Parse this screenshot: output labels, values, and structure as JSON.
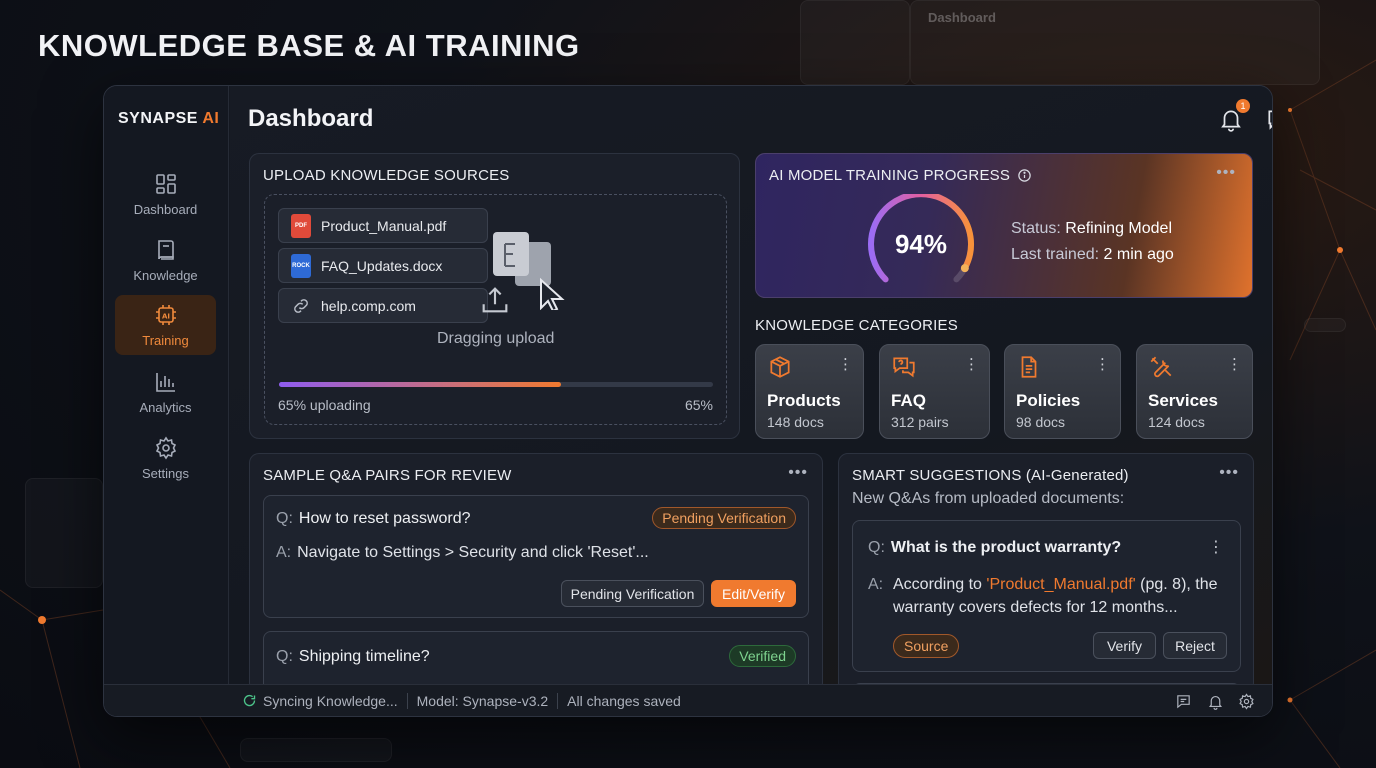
{
  "page_title": "KNOWLEDGE BASE & AI TRAINING",
  "ghost": {
    "title": "Dashboard"
  },
  "app": {
    "logo_main": "SYNAPSE",
    "logo_accent": "AI"
  },
  "sidebar": {
    "items": [
      {
        "label": "Dashboard",
        "icon": "grid-icon",
        "active": false
      },
      {
        "label": "Knowledge",
        "icon": "book-icon",
        "active": false
      },
      {
        "label": "Training",
        "icon": "ai-chip-icon",
        "active": true
      },
      {
        "label": "Analytics",
        "icon": "bar-chart-icon",
        "active": false
      },
      {
        "label": "Settings",
        "icon": "gear-icon",
        "active": false
      }
    ]
  },
  "header": {
    "title": "Dashboard",
    "notification_count": "1"
  },
  "upload": {
    "title": "UPLOAD KNOWLEDGE SOURCES",
    "files": [
      {
        "name": "Product_Manual.pdf",
        "type_label": "PDF",
        "color": "#e04a3a"
      },
      {
        "name": "FAQ_Updates.docx",
        "type_label": "ROCK",
        "color": "#2e6ad6"
      },
      {
        "name": "help.comp.com",
        "type_label": "",
        "color": ""
      }
    ],
    "drag_label": "Dragging upload",
    "progress_label": "65% uploading",
    "progress_pct_label": "65%",
    "progress": 0.65
  },
  "training": {
    "title": "AI MODEL TRAINING PROGRESS",
    "percent_label": "94%",
    "percent": 0.94,
    "status_label": "Status:",
    "status_value": "Refining Model",
    "last_label": "Last trained:",
    "last_value": "2 min ago"
  },
  "categories": {
    "title": "KNOWLEDGE CATEGORIES",
    "items": [
      {
        "name": "Products",
        "count": "148 docs",
        "icon": "box-icon"
      },
      {
        "name": "FAQ",
        "count": "312 pairs",
        "icon": "chat-bubbles-icon"
      },
      {
        "name": "Policies",
        "count": "98 docs",
        "icon": "document-icon"
      },
      {
        "name": "Services",
        "count": "124 docs",
        "icon": "tools-icon"
      }
    ]
  },
  "qa": {
    "title": "SAMPLE Q&A PAIRS FOR REVIEW",
    "items": [
      {
        "q_prefix": "Q:",
        "question": "How to reset password?",
        "a_prefix": "A:",
        "answer": "Navigate to Settings > Security and click 'Reset'...",
        "badge": "Pending Verification",
        "btn_secondary": "Pending Verification",
        "btn_primary": "Edit/Verify"
      },
      {
        "q_prefix": "Q:",
        "question": "Shipping timeline?",
        "badge": "Verified"
      }
    ]
  },
  "suggestions": {
    "title": "SMART SUGGESTIONS (AI-Generated)",
    "subtitle": "New Q&As from uploaded documents:",
    "item": {
      "q_prefix": "Q:",
      "question": "What is the product warranty?",
      "a_prefix": "A:",
      "answer_before": "According to ",
      "answer_source": "'Product_Manual.pdf'",
      "answer_after": " (pg. 8), the warranty covers defects for 12 months...",
      "source_badge": "Source",
      "verify_label": "Verify",
      "reject_label": "Reject"
    }
  },
  "statusbar": {
    "sync": "Syncing Knowledge...",
    "model": "Model: Synapse-v3.2",
    "saved": "All changes saved"
  }
}
